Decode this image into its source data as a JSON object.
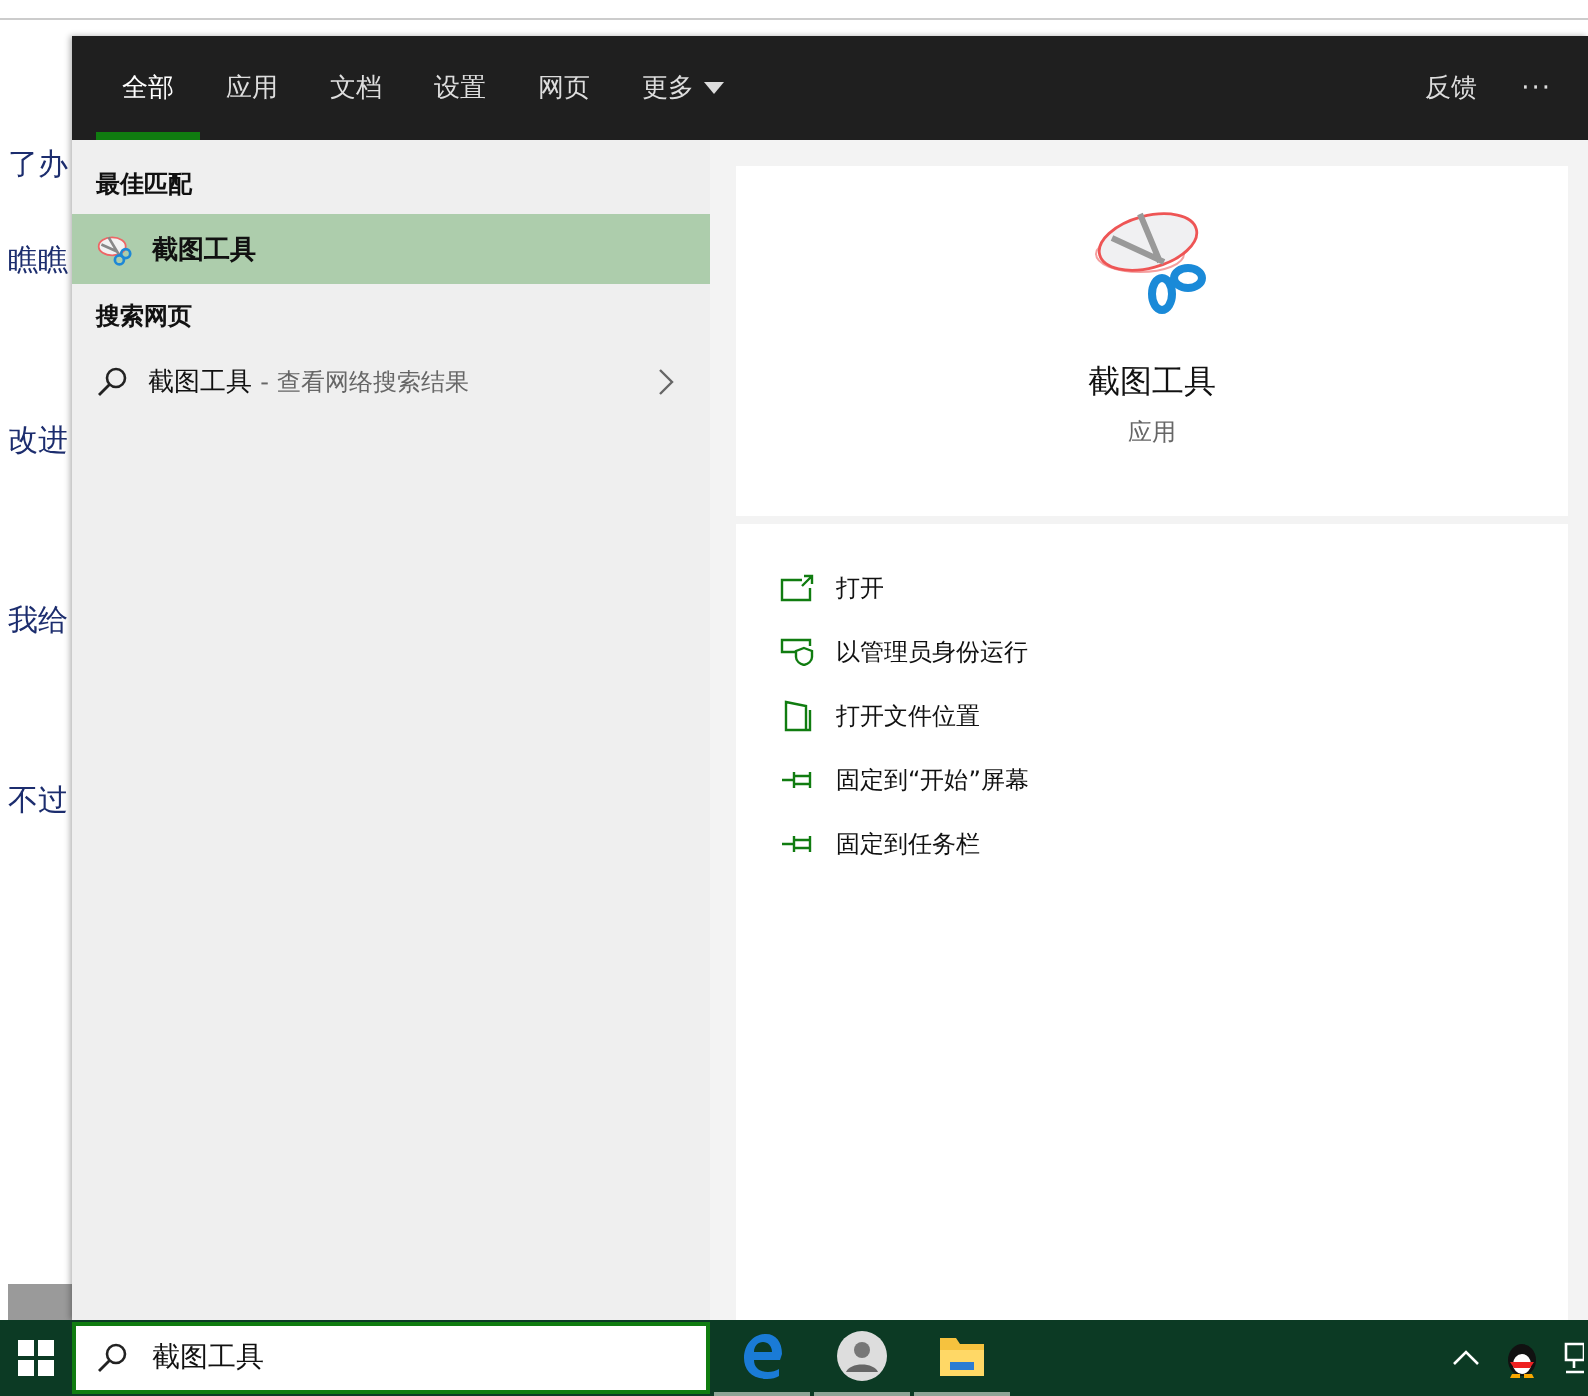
{
  "background_page": {
    "lines": [
      "了办",
      "瞧瞧",
      "改进",
      "我给",
      "不过"
    ]
  },
  "search_panel": {
    "tabs": [
      {
        "label": "全部",
        "selected": true,
        "kind": "tab"
      },
      {
        "label": "应用",
        "selected": false,
        "kind": "tab"
      },
      {
        "label": "文档",
        "selected": false,
        "kind": "tab"
      },
      {
        "label": "设置",
        "selected": false,
        "kind": "tab"
      },
      {
        "label": "网页",
        "selected": false,
        "kind": "tab"
      },
      {
        "label": "更多",
        "selected": false,
        "kind": "dropdown"
      }
    ],
    "feedback": "反馈",
    "menu": "···",
    "sections": [
      {
        "heading": "最佳匹配",
        "items": [
          {
            "kind": "app",
            "title": "截图工具",
            "selected": true
          }
        ]
      },
      {
        "heading": "搜索网页",
        "items": [
          {
            "kind": "web",
            "title": "截图工具",
            "subtitle": "- 查看网络搜索结果",
            "selected": false
          }
        ]
      }
    ],
    "preview": {
      "title": "截图工具",
      "type": "应用",
      "actions": [
        {
          "label": "打开",
          "kind": "open"
        },
        {
          "label": "以管理员身份运行",
          "kind": "admin"
        },
        {
          "label": "打开文件位置",
          "kind": "folder"
        },
        {
          "label": "固定到“开始”屏幕",
          "kind": "pin"
        },
        {
          "label": "固定到任务栏",
          "kind": "pin"
        }
      ]
    }
  },
  "taskbar": {
    "search_value": "截图工具",
    "apps": [
      {
        "kind": "edge"
      },
      {
        "kind": "avatar"
      },
      {
        "kind": "explorer"
      }
    ]
  }
}
